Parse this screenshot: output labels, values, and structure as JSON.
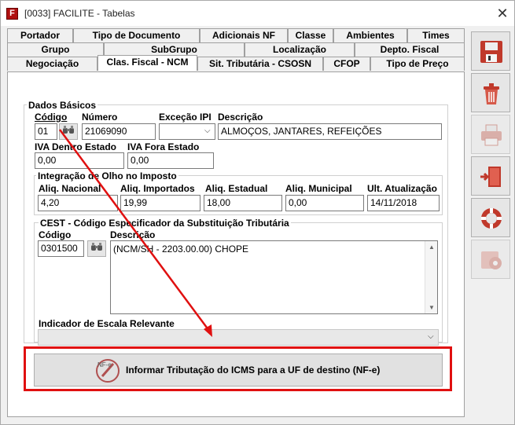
{
  "window": {
    "title": "[0033] FACILITE - Tabelas",
    "close_glyph": "✕"
  },
  "tabs": {
    "row1": [
      "Portador",
      "Tipo de Documento",
      "Adicionais NF",
      "Classe",
      "Ambientes",
      "Times"
    ],
    "row2": [
      "Grupo",
      "SubGrupo",
      "Localização",
      "Depto. Fiscal"
    ],
    "row3": [
      "Negociação",
      "Clas. Fiscal - NCM",
      "Sit. Tributária - CSOSN",
      "CFOP",
      "Tipo de Preço"
    ],
    "active": "Clas. Fiscal - NCM"
  },
  "dados_basicos": {
    "legend": "Dados Básicos",
    "codigo_label": "Código",
    "codigo_value": "01",
    "numero_label": "Número",
    "numero_value": "21069090",
    "excecao_label": "Exceção IPI",
    "excecao_value": "",
    "descricao_label": "Descrição",
    "descricao_value": "ALMOÇOS, JANTARES, REFEIÇÕES",
    "iva_dentro_label": "IVA Dentro Estado",
    "iva_dentro_value": "0,00",
    "iva_fora_label": "IVA Fora Estado",
    "iva_fora_value": "0,00"
  },
  "olho_imposto": {
    "legend": "Integração de Olho no Imposto",
    "nacional_label": "Aliq. Nacional",
    "nacional_value": "4,20",
    "importados_label": "Aliq. Importados",
    "importados_value": "19,99",
    "estadual_label": "Aliq. Estadual",
    "estadual_value": "18,00",
    "municipal_label": "Aliq. Municipal",
    "municipal_value": "0,00",
    "atualizacao_label": "Ult. Atualização",
    "atualizacao_value": "14/11/2018"
  },
  "cest": {
    "legend": "CEST - Código Especificador da Substituição Tributária",
    "codigo_label": "Código",
    "codigo_value": "0301500",
    "descricao_label": "Descrição",
    "descricao_value": "(NCM/SH - 2203.00.00) CHOPE",
    "escala_label": "Indicador de Escala Relevante",
    "escala_value": ""
  },
  "action_button": {
    "label": "Informar Tributação do ICMS para a UF de destino (NF-e)",
    "icon_text": "NF-e"
  },
  "sidebar": [
    "save-icon",
    "delete-icon",
    "print-icon",
    "exit-icon",
    "help-icon",
    "settings-icon"
  ],
  "colors": {
    "annotation": "#e01010",
    "window_bg": "#f0f0f0"
  }
}
